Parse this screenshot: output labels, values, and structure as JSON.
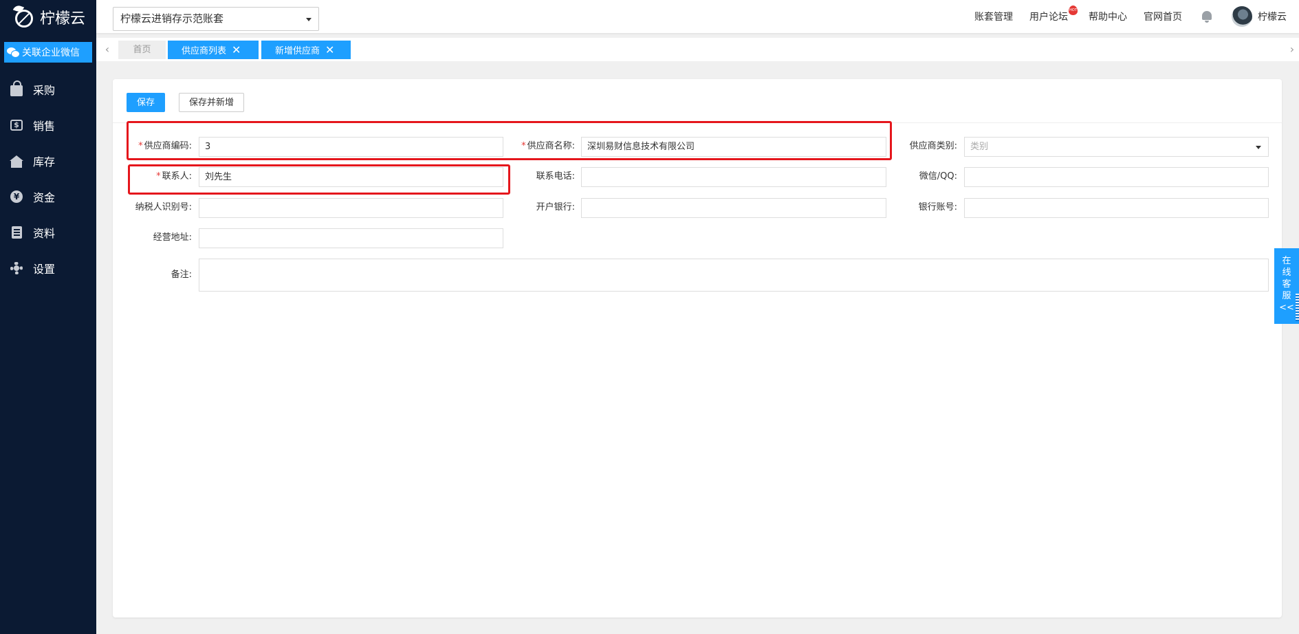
{
  "sidebar": {
    "logo_text": "柠檬云",
    "wework_label": "关联企业微信",
    "items": [
      {
        "label": "采购",
        "icon": "shopping-bag-icon"
      },
      {
        "label": "销售",
        "icon": "money-icon"
      },
      {
        "label": "库存",
        "icon": "warehouse-icon"
      },
      {
        "label": "资金",
        "icon": "yen-coin-icon"
      },
      {
        "label": "资料",
        "icon": "document-icon"
      },
      {
        "label": "设置",
        "icon": "gear-icon"
      }
    ]
  },
  "header": {
    "account_select": "柠檬云进销存示范账套",
    "links": {
      "account_mgmt": "账套管理",
      "forum": "用户论坛",
      "forum_badge": "HOT",
      "help": "帮助中心",
      "website": "官网首页"
    },
    "user_name": "柠檬云"
  },
  "tabs": {
    "prev_arrow": "‹",
    "next_arrow": "›",
    "items": [
      {
        "label": "首页"
      },
      {
        "label": "供应商列表",
        "close": "✕"
      },
      {
        "label": "新增供应商",
        "close": "✕"
      }
    ]
  },
  "toolbar": {
    "save_label": "保存",
    "save_new_label": "保存并新增"
  },
  "form": {
    "code": {
      "label": "供应商编码:",
      "required": "*",
      "value": "3"
    },
    "name": {
      "label": "供应商名称:",
      "required": "*",
      "value": "深圳易财信息技术有限公司"
    },
    "category": {
      "label": "供应商类别:",
      "placeholder": "类别"
    },
    "contact": {
      "label": "联系人:",
      "required": "*",
      "value": "刘先生"
    },
    "phone": {
      "label": "联系电话:",
      "value": ""
    },
    "wechat": {
      "label": "微信/QQ:",
      "value": ""
    },
    "tax_id": {
      "label": "纳税人识别号:",
      "value": ""
    },
    "bank": {
      "label": "开户银行:",
      "value": ""
    },
    "account_no": {
      "label": "银行账号:",
      "value": ""
    },
    "address": {
      "label": "经营地址:",
      "value": ""
    },
    "remark": {
      "label": "备注:",
      "value": ""
    }
  },
  "online_service": {
    "chars": [
      "在",
      "线",
      "客",
      "服",
      "<<"
    ]
  },
  "colors": {
    "sidebar_bg": "#0b1a33",
    "accent": "#1e9fff",
    "highlight": "#e5161c",
    "required": "#e53935"
  }
}
